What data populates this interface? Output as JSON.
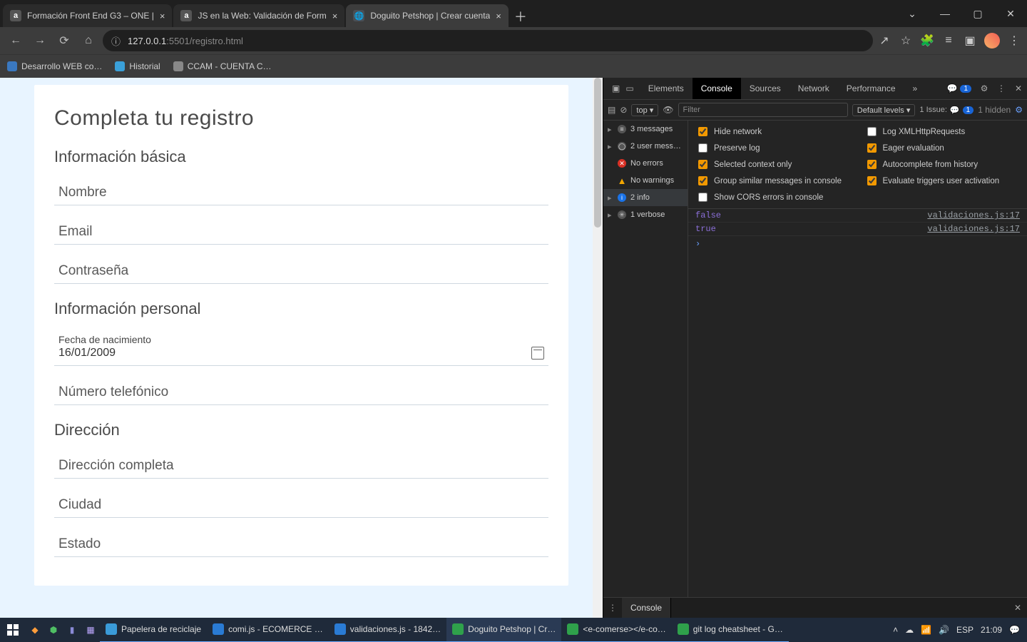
{
  "tabs": [
    {
      "title": "Formación Front End G3 – ONE | ",
      "favicon": "a"
    },
    {
      "title": "JS en la Web: Validación de Form",
      "favicon": "a"
    },
    {
      "title": "Doguito Petshop | Crear cuenta",
      "favicon": "globe",
      "active": true
    }
  ],
  "window_buttons": {
    "chevron": "⌄",
    "min": "—",
    "max": "▢",
    "close": "✕"
  },
  "toolbar": {
    "back": "←",
    "forward": "→",
    "reload": "⟳",
    "home": "⌂",
    "lock": "ⓘ",
    "url_host": "127.0.0.1",
    "url_port": ":5501",
    "url_path": "/registro.html",
    "share": "↗",
    "star": "☆",
    "ext": "🧩",
    "list": "≡",
    "panel": "▣",
    "menu": "⋮"
  },
  "bookmarks": [
    {
      "label": "Desarrollo WEB co…"
    },
    {
      "label": "Historial"
    },
    {
      "label": "CCAM - CUENTA C…"
    }
  ],
  "page": {
    "h1": "Completa tu registro",
    "sec_basic": "Información básica",
    "nombre": "Nombre",
    "email": "Email",
    "password": "Contraseña",
    "sec_personal": "Información personal",
    "dob_label": "Fecha de nacimiento",
    "dob_value": "16/01/2009",
    "phone": "Número telefónico",
    "sec_address": "Dirección",
    "addr_full": "Dirección completa",
    "city": "Ciudad",
    "state": "Estado"
  },
  "devtools": {
    "tabs": {
      "elements": "Elements",
      "console": "Console",
      "sources": "Sources",
      "network": "Network",
      "performance": "Performance",
      "more": "»"
    },
    "feedback_count": "1",
    "toolbar": {
      "ctx": "top ▾",
      "filter_ph": "Filter",
      "levels": "Default levels ▾",
      "issues_label": "1 Issue:",
      "issues_count": "1",
      "hidden": "1 hidden"
    },
    "sidebar": {
      "messages": "3 messages",
      "user": "2 user mess…",
      "errors": "No errors",
      "warnings": "No warnings",
      "info": "2 info",
      "verbose": "1 verbose"
    },
    "settings": {
      "hide_network": {
        "label": "Hide network",
        "checked": true
      },
      "log_xhr": {
        "label": "Log XMLHttpRequests",
        "checked": false
      },
      "preserve": {
        "label": "Preserve log",
        "checked": false
      },
      "eager": {
        "label": "Eager evaluation",
        "checked": true
      },
      "selctx": {
        "label": "Selected context only",
        "checked": true
      },
      "autoc": {
        "label": "Autocomplete from history",
        "checked": true
      },
      "group": {
        "label": "Group similar messages in console",
        "checked": true
      },
      "trig": {
        "label": "Evaluate triggers user activation",
        "checked": true
      },
      "cors": {
        "label": "Show CORS errors in console",
        "checked": false
      }
    },
    "console": [
      {
        "value": "false",
        "src": "validaciones.js:17"
      },
      {
        "value": "true",
        "src": "validaciones.js:17"
      }
    ],
    "drawer": "Console"
  },
  "taskbar": {
    "apps": [
      {
        "label": "Papelera de reciclaje",
        "color": "#3a9bd9"
      },
      {
        "label": "comi.js - ECOMERCE …",
        "color": "#2a7bd4",
        "vs": true
      },
      {
        "label": "validaciones.js - 1842…",
        "color": "#2a7bd4",
        "vs": true
      },
      {
        "label": "Doguito Petshop | Cr…",
        "color": "#2fa14b",
        "chrome": true,
        "open": true
      },
      {
        "label": "<e-comerse></e-co…",
        "color": "#2fa14b",
        "chrome": true
      },
      {
        "label": "git log cheatsheet - G…",
        "color": "#2fa14b",
        "chrome": true
      }
    ],
    "lang": "ESP",
    "time": "21:09"
  }
}
